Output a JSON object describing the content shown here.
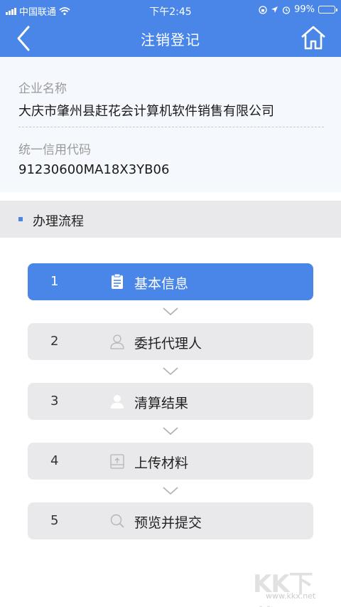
{
  "status_bar": {
    "carrier": "中国联通",
    "time": "下午2:45",
    "battery": "99%",
    "battery_level": 0.99
  },
  "header": {
    "title": "注销登记",
    "back_icon": "chevron-left-icon",
    "home_icon": "home-icon"
  },
  "company": {
    "name_label": "企业名称",
    "name_value": "大庆市肇州县赶花会计算机软件销售有限公司",
    "code_label": "统一信用代码",
    "code_value": "91230600MA18X3YB06"
  },
  "section": {
    "title": "办理流程"
  },
  "steps": [
    {
      "num": "1",
      "label": "基本信息",
      "icon": "clipboard-icon",
      "active": true
    },
    {
      "num": "2",
      "label": "委托代理人",
      "icon": "person-outline-icon",
      "active": false
    },
    {
      "num": "3",
      "label": "清算结果",
      "icon": "person-icon",
      "active": false
    },
    {
      "num": "4",
      "label": "上传材料",
      "icon": "upload-icon",
      "active": false
    },
    {
      "num": "5",
      "label": "预览并提交",
      "icon": "search-icon",
      "active": false
    }
  ],
  "watermark": {
    "text": "KK下载",
    "url": "www.kkx.net"
  },
  "colors": {
    "primary": "#4a86e8",
    "step_bg": "#e9e9eb",
    "info_bg": "#f5f8fd"
  }
}
